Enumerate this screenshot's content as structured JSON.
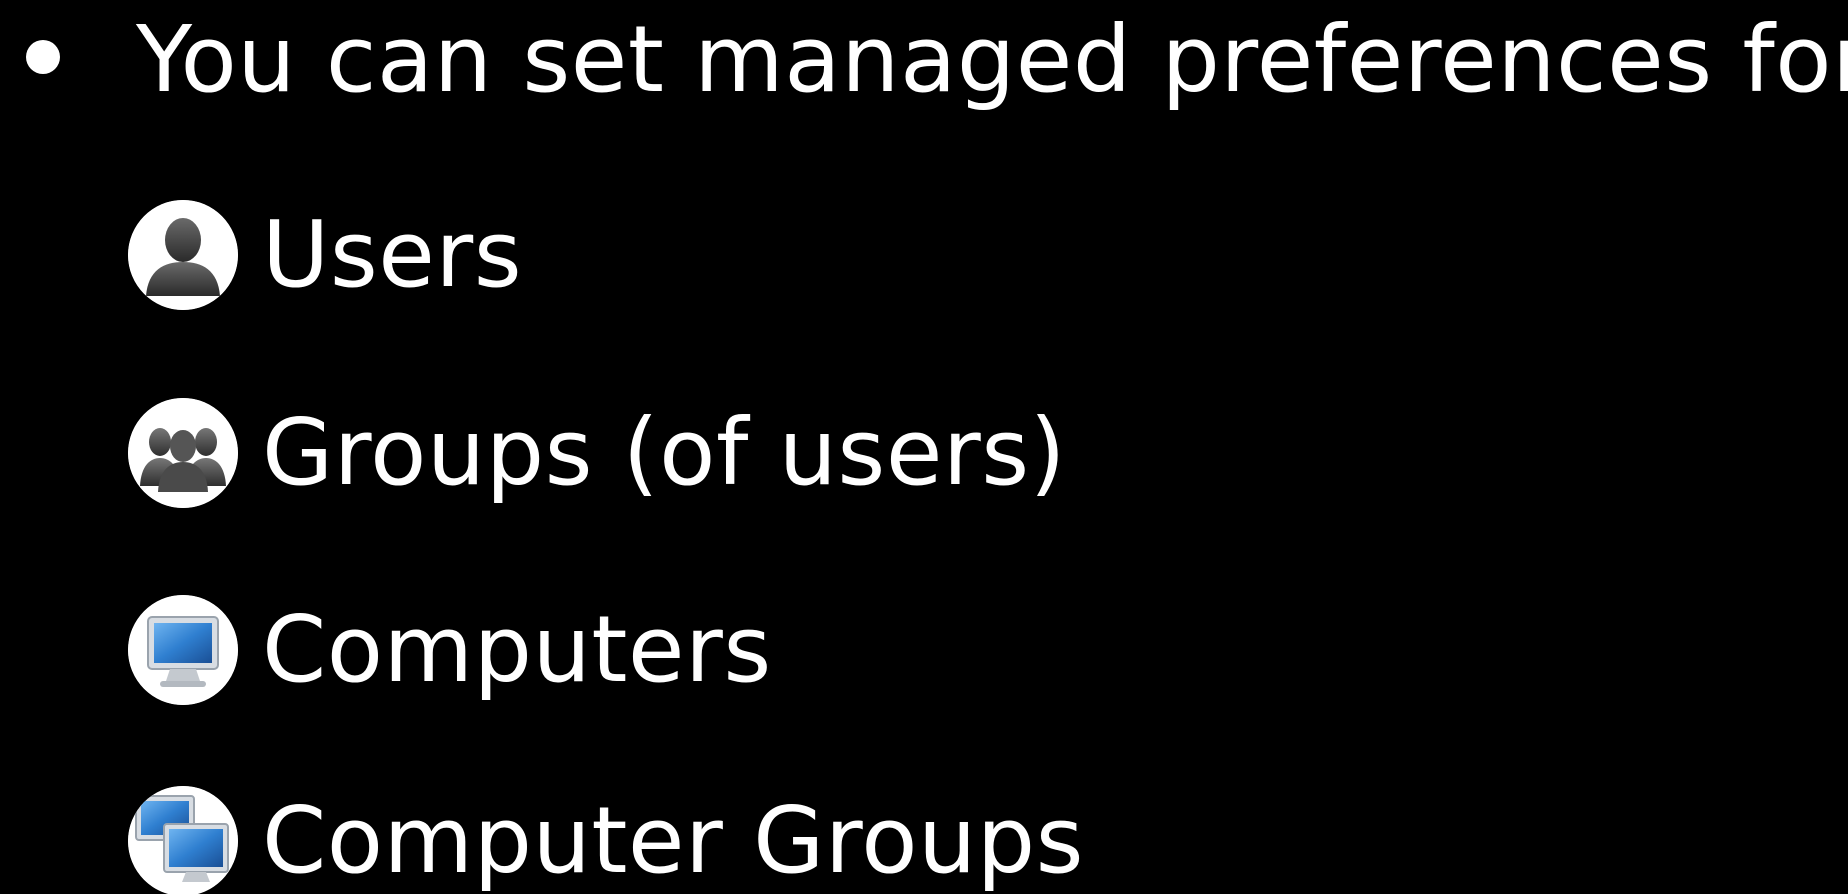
{
  "slide": {
    "heading": "You can set managed preferences for:",
    "items": [
      {
        "label": "Users",
        "icon": "user-icon"
      },
      {
        "label": "Groups (of users)",
        "icon": "group-icon"
      },
      {
        "label": "Computers",
        "icon": "computer-icon"
      },
      {
        "label": "Computer Groups",
        "icon": "computer-group-icon"
      }
    ]
  },
  "colors": {
    "background": "#000000",
    "text": "#ffffff",
    "icon_background": "#ffffff",
    "silhouette": "#3a3a3a",
    "screen_blue": "#2f7fd0"
  }
}
